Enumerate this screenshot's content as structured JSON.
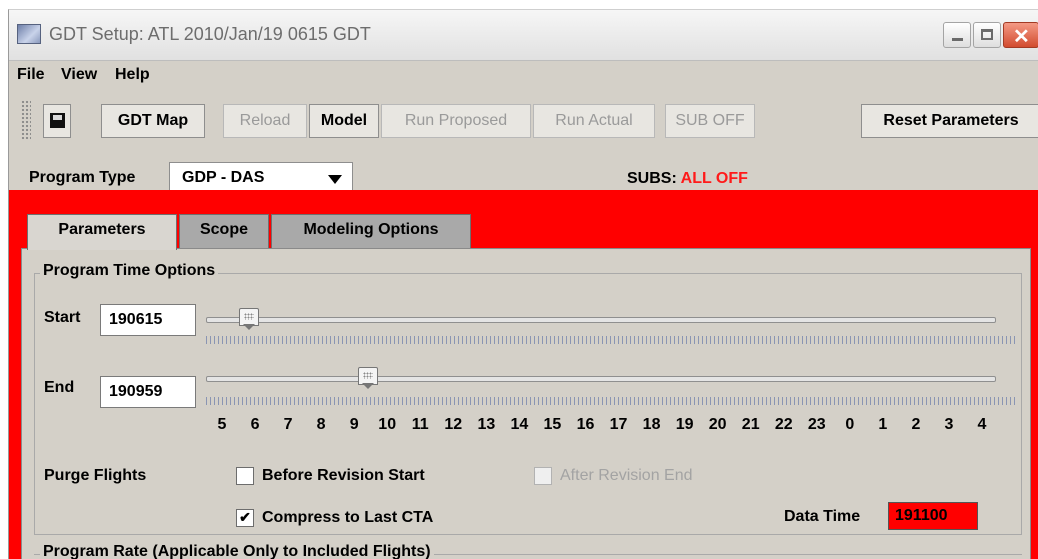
{
  "window": {
    "title": "GDT Setup: ATL 2010/Jan/19 0615 GDT"
  },
  "menu": {
    "file": "File",
    "view": "View",
    "help": "Help"
  },
  "toolbar": {
    "gdt_map": "GDT Map",
    "reload": "Reload",
    "model": "Model",
    "run_proposed": "Run Proposed",
    "run_actual": "Run Actual",
    "sub_off": "SUB OFF",
    "reset_parameters": "Reset Parameters"
  },
  "program_type": {
    "label": "Program Type",
    "value": "GDP - DAS"
  },
  "subs": {
    "label": "SUBS:",
    "value": "ALL OFF"
  },
  "tabs": [
    "Parameters",
    "Scope",
    "Modeling Options"
  ],
  "time_options": {
    "title": "Program Time Options",
    "start_label": "Start",
    "start_value": "190615",
    "end_label": "End",
    "end_value": "190959",
    "hour_labels": [
      "5",
      "6",
      "7",
      "8",
      "9",
      "10",
      "11",
      "12",
      "13",
      "14",
      "15",
      "16",
      "17",
      "18",
      "19",
      "20",
      "21",
      "22",
      "23",
      "0",
      "1",
      "2",
      "3",
      "4"
    ],
    "start_slider_fraction": 0.055,
    "end_slider_fraction": 0.205
  },
  "purge": {
    "label": "Purge Flights",
    "before_revision_start": "Before Revision Start",
    "after_revision_end": "After Revision End",
    "compress_label": "Compress to Last CTA",
    "compress_check": "✔"
  },
  "data_time": {
    "label": "Data Time",
    "value": "191100"
  },
  "program_rate": {
    "title": "Program Rate (Applicable Only to Included Flights)"
  },
  "colors": {
    "alert_red": "#ff0000",
    "subs_red": "#ff1a1a"
  }
}
